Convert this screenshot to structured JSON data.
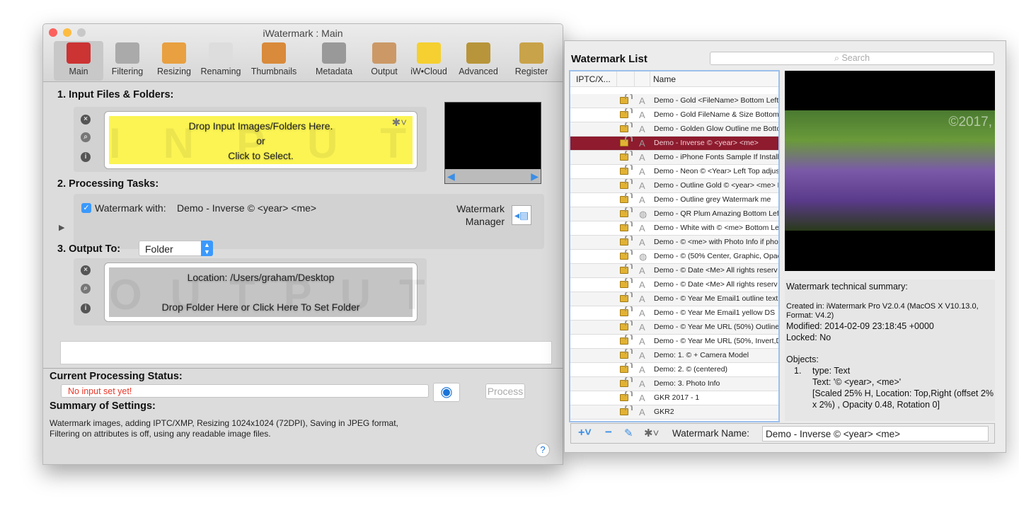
{
  "main_window": {
    "title": "iWatermark : Main",
    "toolbar": [
      {
        "label": "Main",
        "icon": "joystick-icon"
      },
      {
        "label": "Filtering",
        "icon": "funnel-icon"
      },
      {
        "label": "Resizing",
        "icon": "resize-icon"
      },
      {
        "label": "Renaming",
        "icon": "rename-icon"
      },
      {
        "label": "Thumbnails",
        "icon": "thumbnails-icon"
      },
      {
        "label": "Metadata",
        "icon": "metadata-badge-icon"
      },
      {
        "label": "Output",
        "icon": "output-pen-icon"
      },
      {
        "label": "iW•Cloud",
        "icon": "cloud-icon"
      },
      {
        "label": "Advanced",
        "icon": "gear-icon"
      },
      {
        "label": "Register",
        "icon": "key-icon"
      }
    ],
    "selected_tool": "Main",
    "input": {
      "heading": "1. Input Files & Folders:",
      "line1": "Drop Input Images/Folders Here.",
      "line2": "or",
      "line3": "Click to Select.",
      "watermark_text": "INPUT",
      "color": "#fbf453"
    },
    "tasks": {
      "heading": "2. Processing Tasks:",
      "checkbox_label": "Watermark with:",
      "checked": true,
      "watermark_value": "Demo - Inverse © <year> <me>",
      "manager_line1": "Watermark",
      "manager_line2": "Manager"
    },
    "output": {
      "heading": "3. Output To:",
      "select_value": "Folder",
      "location": "Location: /Users/graham/Desktop",
      "drop_text": "Drop Folder Here or Click Here To Set Folder",
      "watermark_text": "OUTPUT"
    },
    "status": {
      "heading": "Current Processing Status:",
      "value": "No input set yet!",
      "value_color": "#e8372a",
      "process_label": "Process"
    },
    "summary": {
      "heading": "Summary of Settings:",
      "line1": "Watermark images, adding IPTC/XMP, Resizing 1024x1024 (72DPI), Saving in JPEG format,",
      "line2": "Filtering on attributes is off, using any readable image files."
    },
    "help": "?"
  },
  "list_window": {
    "title": "Watermark List",
    "search_placeholder": "Search",
    "columns": [
      "IPTC/X...",
      "",
      "",
      "Name"
    ],
    "rows": [
      {
        "name": "Demo - Gold <FileName> Bottom Left",
        "type": "text"
      },
      {
        "name": "Demo - Gold FileName & Size Bottom",
        "type": "text"
      },
      {
        "name": "Demo - Golden Glow Outline me Botto",
        "type": "text"
      },
      {
        "name": "Demo - Inverse © <year> <me>",
        "type": "text",
        "selected": true
      },
      {
        "name": "Demo - iPhone Fonts Sample If Installe",
        "type": "text"
      },
      {
        "name": "Demo - Neon © <Year> Left Top adjus",
        "type": "text"
      },
      {
        "name": "Demo - Outline Gold © <year> <me> E",
        "type": "text"
      },
      {
        "name": "Demo - Outline grey Watermark me",
        "type": "text"
      },
      {
        "name": "Demo - QR Plum Amazing Bottom Left",
        "type": "graphic"
      },
      {
        "name": "Demo - White with © <me> Bottom Le",
        "type": "text"
      },
      {
        "name": "Demo - © <me> with Photo Info if pho",
        "type": "text"
      },
      {
        "name": "Demo - © (50% Center, Graphic, Opac",
        "type": "graphic"
      },
      {
        "name": "Demo - © Date <Me> All rights reserv",
        "type": "text"
      },
      {
        "name": "Demo - © Date <Me> All rights reserv",
        "type": "text"
      },
      {
        "name": "Demo - © Year Me Email1 outline text",
        "type": "text"
      },
      {
        "name": "Demo - © Year Me Email1 yellow DS",
        "type": "text"
      },
      {
        "name": "Demo - © Year Me URL (50%) Outline",
        "type": "text"
      },
      {
        "name": "Demo - © Year Me URL (50%, Invert,D",
        "type": "text"
      },
      {
        "name": "Demo: 1. © + Camera Model",
        "type": "text"
      },
      {
        "name": "Demo: 2. © (centered)",
        "type": "text"
      },
      {
        "name": "Demo: 3. Photo Info",
        "type": "text"
      },
      {
        "name": "GKR 2017 - 1",
        "type": "text"
      },
      {
        "name": "GKR2",
        "type": "text"
      }
    ],
    "selection_color": "#8e1b2e",
    "preview_overlay": "©2017,",
    "tech": {
      "heading": "Watermark technical summary:",
      "created": "Created in: iWatermark Pro V2.0.4 (MacOS X V10.13.0, Format: V4.2)",
      "modified": "Modified: 2014-02-09 23:18:45 +0000",
      "locked": "Locked: No",
      "objects": "Objects:",
      "num": "1.",
      "type": "type: Text",
      "text": "Text: '© <year>, <me>'",
      "details": "[Scaled 25% H, Location: Top,Right (offset 2% x 2%) , Opacity 0.48, Rotation 0]"
    },
    "name_label": "Watermark Name:",
    "name_value": "Demo - Inverse © <year> <me>"
  }
}
